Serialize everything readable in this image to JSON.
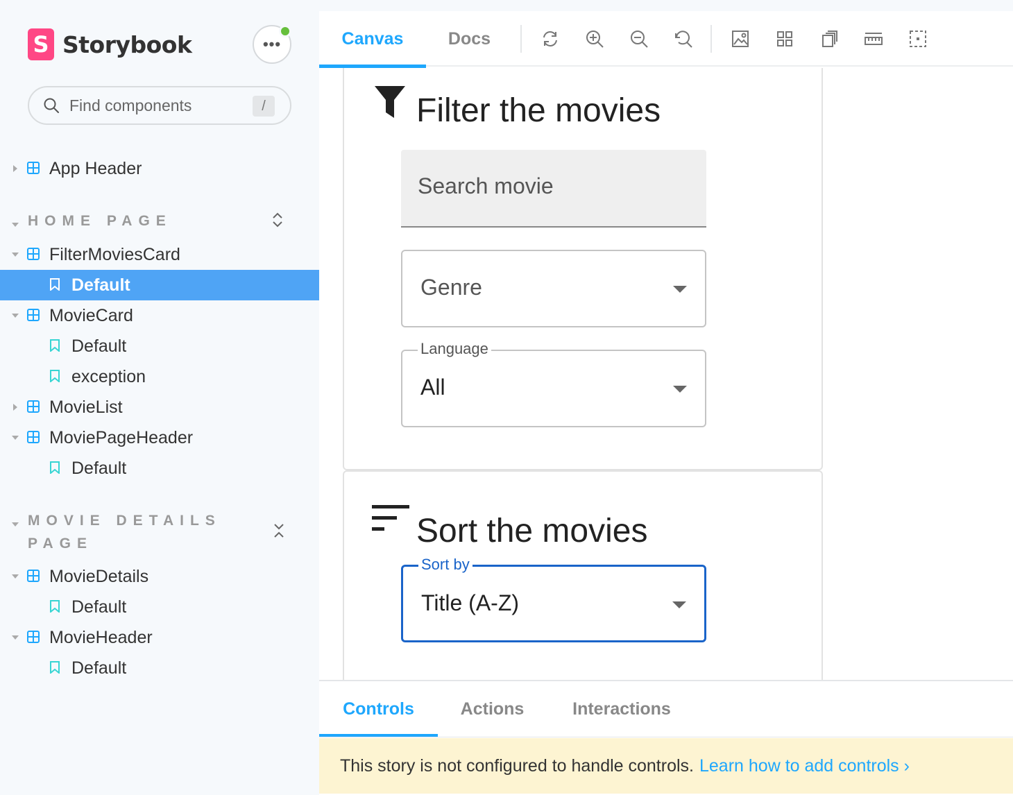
{
  "brand": {
    "name": "Storybook",
    "logo_letter": "S",
    "accent": "#ff4785"
  },
  "menu": {
    "label": "•••",
    "status_color": "#66bf3c"
  },
  "search": {
    "placeholder": "Find components",
    "shortcut": "/"
  },
  "sidebar": {
    "top_items": [
      {
        "type": "component",
        "label": "App Header",
        "expanded": false
      }
    ],
    "groups": [
      {
        "title": "HOME PAGE",
        "items": [
          {
            "type": "component",
            "label": "FilterMoviesCard",
            "expanded": true
          },
          {
            "type": "story",
            "label": "Default",
            "selected": true
          },
          {
            "type": "component",
            "label": "MovieCard",
            "expanded": true
          },
          {
            "type": "story",
            "label": "Default"
          },
          {
            "type": "story",
            "label": "exception"
          },
          {
            "type": "component",
            "label": "MovieList",
            "expanded": false
          },
          {
            "type": "component",
            "label": "MoviePageHeader",
            "expanded": true
          },
          {
            "type": "story",
            "label": "Default"
          }
        ]
      },
      {
        "title_line1": "MOVIE DETAILS",
        "title_line2": "PAGE",
        "items": [
          {
            "type": "component",
            "label": "MovieDetails",
            "expanded": true
          },
          {
            "type": "story",
            "label": "Default"
          },
          {
            "type": "component",
            "label": "MovieHeader",
            "expanded": true
          },
          {
            "type": "story",
            "label": "Default"
          }
        ]
      }
    ],
    "selected_color": "#4fa4f5"
  },
  "toolbar": {
    "tabs": [
      {
        "label": "Canvas",
        "active": true
      },
      {
        "label": "Docs",
        "active": false
      }
    ],
    "icons": [
      "sync-icon",
      "zoom-in-icon",
      "zoom-out-icon",
      "zoom-reset-icon",
      "background-icon",
      "grid-icon",
      "viewport-icon",
      "measure-icon",
      "outline-icon"
    ]
  },
  "filter_card": {
    "title": "Filter the movies",
    "search_placeholder": "Search movie",
    "genre_placeholder": "Genre",
    "language_label": "Language",
    "language_value": "All"
  },
  "sort_card": {
    "title": "Sort the movies",
    "sort_label": "Sort by",
    "sort_value": "Title (A-Z)",
    "focus_color": "#1a64c9"
  },
  "panel": {
    "tabs": [
      {
        "label": "Controls",
        "active": true
      },
      {
        "label": "Actions",
        "active": false
      },
      {
        "label": "Interactions",
        "active": false
      }
    ],
    "notice_text": "This story is not configured to handle controls.",
    "notice_link": "Learn how to add controls ›",
    "accent": "#1ea7fd"
  }
}
